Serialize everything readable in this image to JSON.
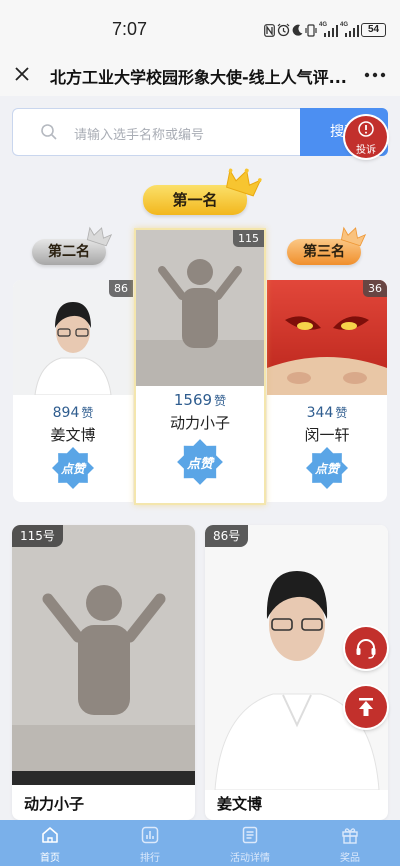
{
  "theme": {
    "accent": "#4c8ff2",
    "danger": "#c2302c",
    "nav": "#7ab0ea",
    "likes": "#2f5d8f"
  },
  "status_bar": {
    "time": "7:07",
    "network_1": "4G",
    "network_2": "4G",
    "battery": "54"
  },
  "header": {
    "title": "北方工业大学校园形象大使-线上人气评...",
    "close_icon": "close-icon",
    "more_icon": "more-icon"
  },
  "search": {
    "placeholder": "请输入选手名称或编号",
    "button_label": "搜索"
  },
  "complaint": {
    "label": "投诉",
    "icon": "alert-icon"
  },
  "podium": {
    "first": {
      "rank_label": "第一名",
      "number": "115",
      "likes": "1569",
      "likes_unit": "赞",
      "name": "动力小子",
      "vote_label": "点赞"
    },
    "second": {
      "rank_label": "第二名",
      "number": "86",
      "likes": "894",
      "likes_unit": "赞",
      "name": "姜文博",
      "vote_label": "点赞"
    },
    "third": {
      "rank_label": "第三名",
      "number": "36",
      "likes": "344",
      "likes_unit": "赞",
      "name": "闵一轩",
      "vote_label": "点赞"
    }
  },
  "contestants": [
    {
      "number_label": "115号",
      "name": "动力小子"
    },
    {
      "number_label": "86号",
      "name": "姜文博"
    }
  ],
  "floating": {
    "service_icon": "headset-icon",
    "top_icon": "arrow-up-icon"
  },
  "nav": [
    {
      "label": "首页",
      "icon": "home-icon",
      "active": true
    },
    {
      "label": "排行",
      "icon": "ranking-icon",
      "active": false
    },
    {
      "label": "活动详情",
      "icon": "details-icon",
      "active": false
    },
    {
      "label": "奖品",
      "icon": "gift-icon",
      "active": false
    }
  ]
}
